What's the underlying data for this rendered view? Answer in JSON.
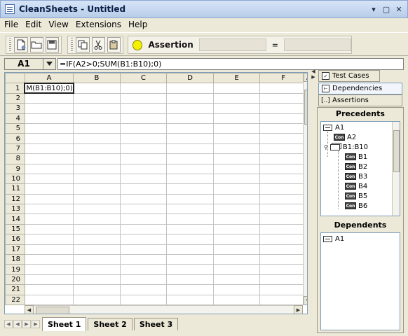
{
  "window": {
    "title": "CleanSheets - Untitled"
  },
  "menu": {
    "items": [
      "File",
      "Edit",
      "View",
      "Extensions",
      "Help"
    ]
  },
  "toolbar": {
    "buttons": [
      "new-file-icon",
      "open-folder-icon",
      "save-disk-icon",
      "copy-icon",
      "cut-scissors-icon",
      "paste-clipboard-icon"
    ],
    "assertion_label": "Assertion",
    "equals_label": "=",
    "assertion_status_color": "#f5f000"
  },
  "formula_bar": {
    "cell_ref": "A1",
    "formula": "=IF(A2>0;SUM(B1:B10);0)"
  },
  "grid": {
    "columns": [
      "A",
      "B",
      "C",
      "D",
      "E",
      "F"
    ],
    "rows": [
      "1",
      "2",
      "3",
      "4",
      "5",
      "6",
      "7",
      "8",
      "9",
      "10",
      "11",
      "12",
      "13",
      "14",
      "15",
      "16",
      "17",
      "18",
      "19",
      "20",
      "21",
      "22"
    ],
    "a1_display": "M(B1:B10);0)"
  },
  "sheet_tabs": [
    "Sheet 1",
    "Sheet 2",
    "Sheet 3"
  ],
  "side_panel": {
    "tabs": {
      "test_cases": "Test Cases",
      "dependencies": "Dependencies",
      "assertions": "Assertions"
    },
    "precedents_title": "Precedents",
    "dependents_title": "Dependents",
    "precedents": {
      "root": "A1",
      "child1": "A2",
      "range": "B1:B10",
      "range_children": [
        "B1",
        "B2",
        "B3",
        "B4",
        "B5",
        "B6"
      ]
    },
    "dependents": [
      "A1"
    ]
  }
}
